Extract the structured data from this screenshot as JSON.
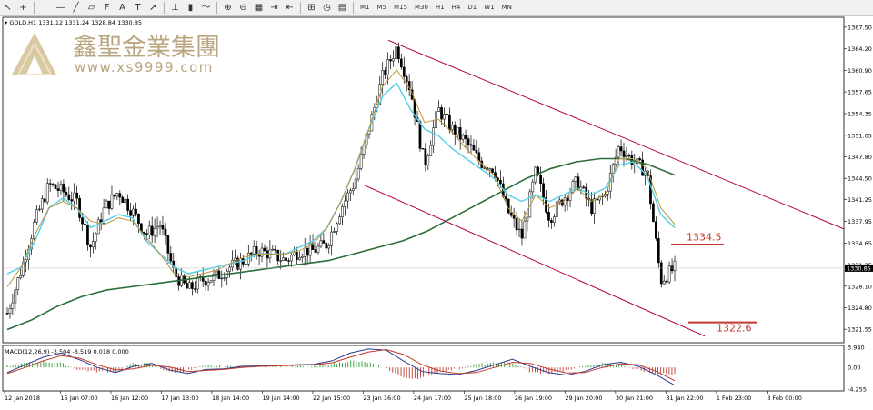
{
  "toolbar": {
    "timeframes": [
      "M1",
      "M5",
      "M15",
      "M30",
      "H1",
      "H4",
      "D1",
      "W1",
      "MN"
    ],
    "icons": [
      "cursor-icon",
      "crosshair-icon",
      "vertical-line-icon",
      "horizontal-line-icon",
      "trendline-icon",
      "channel-icon",
      "fibo-icon",
      "text-icon",
      "label-icon",
      "arrow-icon",
      "bar-chart-icon",
      "candle-chart-icon",
      "line-chart-icon",
      "zoom-in-icon",
      "zoom-out-icon",
      "tile-icon",
      "scroll-icon",
      "shift-icon",
      "indicators-icon",
      "periods-icon",
      "templates-icon"
    ]
  },
  "watermark": {
    "company": "鑫聖金業集團",
    "url": "www.xs9999.com"
  },
  "colors": {
    "up_candle": "#000000",
    "down_candle": "#000000",
    "channel": "#b0003a",
    "ma_fast": "#5ad0e8",
    "ma_mid": "#b8953a",
    "ma_slow": "#2a6e3a",
    "macd_pos": "#2e9c2e",
    "macd_neg": "#c0392b",
    "level": "#c0392b"
  },
  "chart_data": {
    "type": "candlestick",
    "title": "GOLD,H1  1331.12 1331.24 1328.84 1330.85",
    "symbol": "GOLD,H1",
    "ohlc_header": "1331.12 1331.24 1328.84 1330.85",
    "current_price": "1330.85",
    "ylim": [
      1319.5,
      1369.0
    ],
    "price_ticks": [
      "1367.50",
      "1364.20",
      "1360.90",
      "1357.65",
      "1354.35",
      "1351.05",
      "1347.80",
      "1344.50",
      "1341.25",
      "1337.95",
      "1334.65",
      "1331.35",
      "1328.10",
      "1324.80",
      "1321.55"
    ],
    "x_ticks": [
      "12 Jan 2018",
      "15 Jan 07:00",
      "16 Jan 12:00",
      "17 Jan 13:00",
      "18 Jan 14:00",
      "19 Jan 14:00",
      "22 Jan 15:00",
      "23 Jan 16:00",
      "24 Jan 17:00",
      "25 Jan 18:00",
      "26 Jan 19:00",
      "29 Jan 20:00",
      "30 Jan 21:00",
      "31 Jan 22:00",
      "1 Feb 23:00",
      "3 Feb 00:00"
    ],
    "close_path": [
      1324.0,
      1330.5,
      1338.0,
      1343.5,
      1342.5,
      1341.0,
      1334.0,
      1340.0,
      1342.5,
      1339.5,
      1336.0,
      1337.5,
      1330.0,
      1327.5,
      1329.0,
      1329.5,
      1331.0,
      1332.0,
      1333.5,
      1333.0,
      1332.0,
      1333.5,
      1333.5,
      1334.5,
      1340.0,
      1344.0,
      1352.0,
      1360.0,
      1364.5,
      1358.0,
      1346.5,
      1355.0,
      1352.0,
      1350.0,
      1347.0,
      1346.0,
      1339.5,
      1335.5,
      1345.5,
      1338.5,
      1341.5,
      1344.0,
      1340.0,
      1342.0,
      1349.5,
      1347.0,
      1345.5,
      1329.0,
      1330.85
    ],
    "ma_fast": [
      1330.0,
      1331.0,
      1335.0,
      1340.0,
      1341.5,
      1340.0,
      1337.0,
      1338.0,
      1339.0,
      1338.5,
      1335.0,
      1333.0,
      1331.0,
      1330.0,
      1330.5,
      1331.0,
      1331.5,
      1332.0,
      1333.0,
      1333.0,
      1333.0,
      1334.0,
      1335.0,
      1337.0,
      1341.0,
      1346.0,
      1352.0,
      1357.0,
      1359.0,
      1355.0,
      1352.0,
      1351.0,
      1349.0,
      1347.5,
      1346.0,
      1344.5,
      1342.0,
      1341.0,
      1342.0,
      1341.0,
      1342.0,
      1343.0,
      1342.0,
      1343.0,
      1346.5,
      1347.0,
      1345.0,
      1339.0,
      1337.0
    ],
    "ma_mid": [
      1328.0,
      1331.0,
      1336.0,
      1340.0,
      1341.0,
      1340.0,
      1338.0,
      1337.5,
      1338.5,
      1338.0,
      1335.5,
      1333.0,
      1330.0,
      1329.5,
      1330.0,
      1330.5,
      1331.5,
      1332.5,
      1333.0,
      1333.0,
      1333.0,
      1333.5,
      1334.5,
      1337.0,
      1341.0,
      1346.0,
      1352.0,
      1358.5,
      1361.0,
      1358.0,
      1353.0,
      1353.5,
      1351.5,
      1349.0,
      1347.0,
      1345.0,
      1340.0,
      1338.0,
      1342.0,
      1340.0,
      1341.0,
      1343.0,
      1341.0,
      1342.0,
      1347.5,
      1347.5,
      1346.0,
      1340.0,
      1337.5
    ],
    "ma_slow": [
      1321.5,
      1323.0,
      1325.0,
      1326.5,
      1327.5,
      1328.0,
      1328.5,
      1329.0,
      1329.5,
      1330.0,
      1330.5,
      1331.0,
      1331.5,
      1332.0,
      1333.0,
      1334.0,
      1335.0,
      1336.5,
      1338.5,
      1340.5,
      1342.5,
      1344.5,
      1346.0,
      1347.0,
      1347.5,
      1347.5,
      1346.5,
      1345.0
    ],
    "channel_upper": {
      "from": {
        "date": "24 Jan 17:00",
        "price": 1365.5
      },
      "to": {
        "date": "4 Feb",
        "price": 1336.8
      }
    },
    "channel_lower": {
      "from": {
        "date": "22 Jan 15:00",
        "price": 1343.5
      },
      "to": {
        "date": "3 Feb 00:00",
        "price": 1320.5
      }
    },
    "levels": [
      {
        "label": "1334.5",
        "price": 1334.5
      },
      {
        "label": "1322.6",
        "price": 1322.6
      }
    ]
  },
  "macd": {
    "label": "MACD(12,26,9) -3.504 -3.519 0.018 0.000",
    "ticks": [
      "3.940",
      "0.00",
      "-4.255"
    ],
    "ylim": [
      -4.6,
      4.3
    ],
    "main": [
      -1.0,
      0.5,
      2.0,
      2.8,
      1.5,
      0.0,
      -1.0,
      0.2,
      0.8,
      -0.5,
      -1.2,
      -0.4,
      -0.3,
      0.2,
      0.3,
      0.4,
      0.5,
      0.6,
      1.3,
      2.8,
      3.6,
      3.4,
      1.2,
      -0.8,
      -1.2,
      -1.4,
      -0.6,
      0.5,
      1.6,
      0.2,
      -1.0,
      -1.5,
      -0.8,
      0.5,
      1.0,
      0.2,
      -1.5,
      -3.5
    ],
    "signal": [
      -1.2,
      0.0,
      1.3,
      2.3,
      1.8,
      0.5,
      -0.5,
      -0.3,
      0.4,
      0.1,
      -0.8,
      -0.6,
      -0.4,
      0.0,
      0.2,
      0.3,
      0.4,
      0.5,
      0.9,
      2.0,
      3.0,
      3.5,
      2.5,
      0.5,
      -0.7,
      -1.2,
      -1.0,
      0.0,
      1.0,
      0.8,
      -0.3,
      -1.1,
      -1.0,
      0.0,
      0.7,
      0.5,
      -0.8,
      -2.6
    ]
  }
}
